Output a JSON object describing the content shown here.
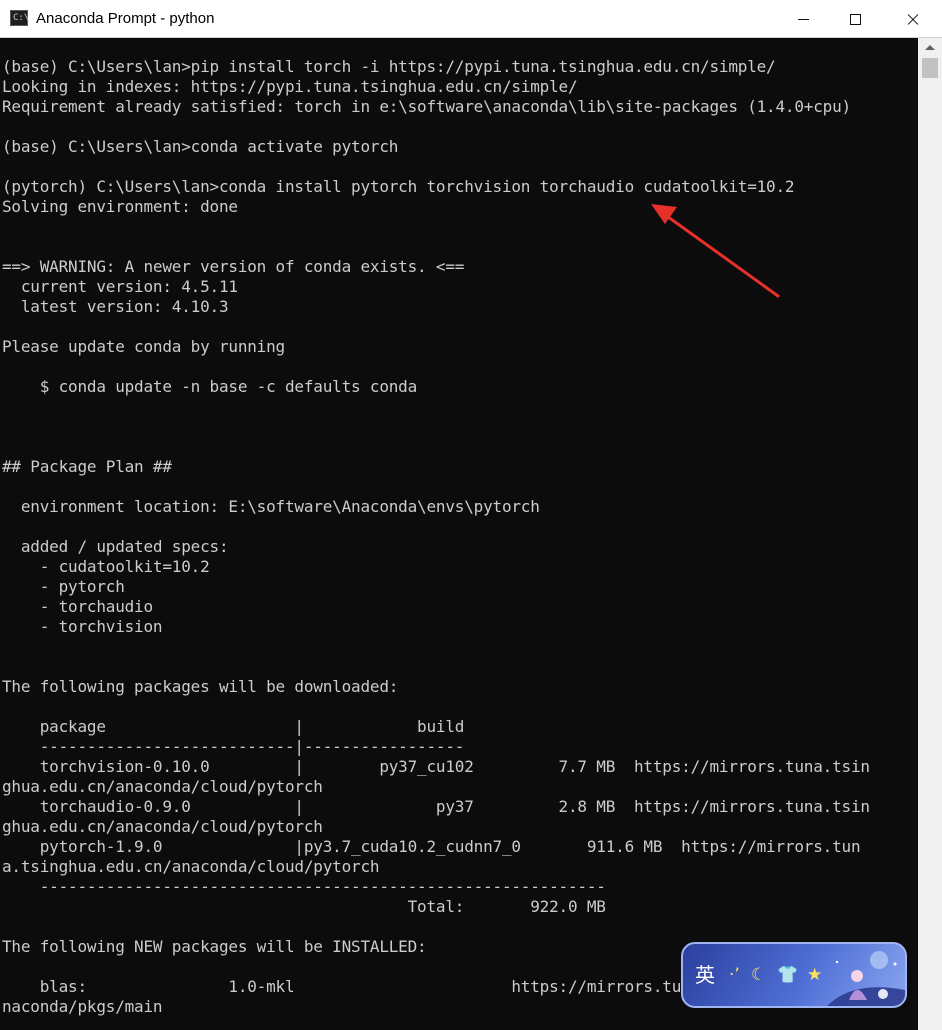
{
  "window": {
    "title": "Anaconda Prompt - python",
    "icon": "terminal-app-icon",
    "controls": [
      "minimize-icon",
      "maximize-icon",
      "close-icon"
    ]
  },
  "console": {
    "lines": [
      "(base) C:\\Users\\lan>pip install torch -i https://pypi.tuna.tsinghua.edu.cn/simple/",
      "Looking in indexes: https://pypi.tuna.tsinghua.edu.cn/simple/",
      "Requirement already satisfied: torch in e:\\software\\anaconda\\lib\\site-packages (1.4.0+cpu)",
      "",
      "(base) C:\\Users\\lan>conda activate pytorch",
      "",
      "(pytorch) C:\\Users\\lan>conda install pytorch torchvision torchaudio cudatoolkit=10.2",
      "Solving environment: done",
      "",
      "",
      "==> WARNING: A newer version of conda exists. <==",
      "  current version: 4.5.11",
      "  latest version: 4.10.3",
      "",
      "Please update conda by running",
      "",
      "    $ conda update -n base -c defaults conda",
      "",
      "",
      "",
      "## Package Plan ##",
      "",
      "  environment location: E:\\software\\Anaconda\\envs\\pytorch",
      "",
      "  added / updated specs:",
      "    - cudatoolkit=10.2",
      "    - pytorch",
      "    - torchaudio",
      "    - torchvision",
      "",
      "",
      "The following packages will be downloaded:",
      "",
      "    package                    |            build",
      "    ---------------------------|-----------------",
      "    torchvision-0.10.0         |        py37_cu102         7.7 MB  https://mirrors.tuna.tsin",
      "ghua.edu.cn/anaconda/cloud/pytorch",
      "    torchaudio-0.9.0           |              py37         2.8 MB  https://mirrors.tuna.tsin",
      "ghua.edu.cn/anaconda/cloud/pytorch",
      "    pytorch-1.9.0              |py3.7_cuda10.2_cudnn7_0       911.6 MB  https://mirrors.tun",
      "a.tsinghua.edu.cn/anaconda/cloud/pytorch",
      "    ------------------------------------------------------------",
      "                                           Total:       922.0 MB",
      "",
      "The following NEW packages will be INSTALLED:",
      "",
      "    blas:               1.0-mkl                       https://mirrors.tuna.tsinghua.edu.cn/a",
      "naconda/pkgs/main"
    ]
  },
  "ime_toolbar": {
    "language": "英",
    "icons": [
      "punctuation-icon",
      "moon-icon",
      "skin-tshirt-icon",
      "star-icon"
    ]
  },
  "colors": {
    "console_bg": "#0c0c0c",
    "console_text": "#cccccc",
    "annotation_arrow": "#e8302a",
    "ime_bg": "#3c56c4"
  }
}
